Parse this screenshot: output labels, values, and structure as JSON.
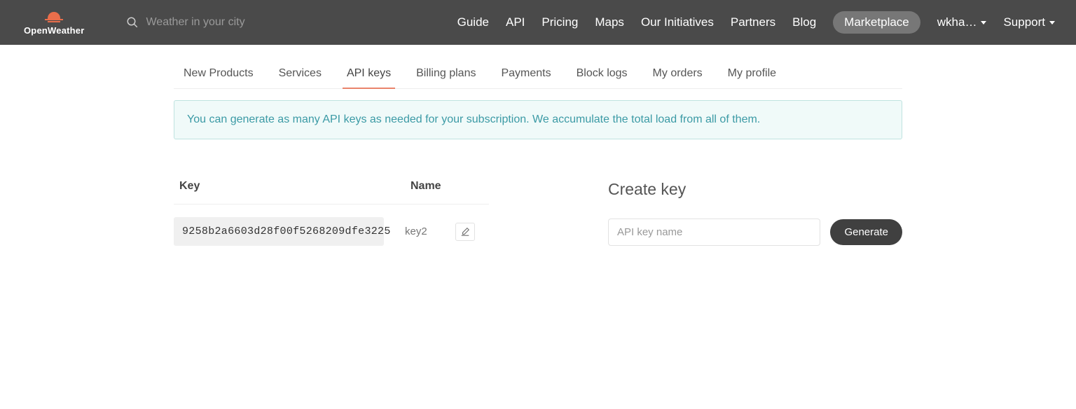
{
  "brand": {
    "name": "OpenWeather"
  },
  "search": {
    "placeholder": "Weather in your city"
  },
  "nav": {
    "guide": "Guide",
    "api": "API",
    "pricing": "Pricing",
    "maps": "Maps",
    "initiatives": "Our Initiatives",
    "partners": "Partners",
    "blog": "Blog",
    "marketplace": "Marketplace",
    "user": "wkha…",
    "support": "Support"
  },
  "tabs": {
    "new_products": "New Products",
    "services": "Services",
    "api_keys": "API keys",
    "billing": "Billing plans",
    "payments": "Payments",
    "block_logs": "Block logs",
    "my_orders": "My orders",
    "my_profile": "My profile"
  },
  "banner": "You can generate as many API keys as needed for your subscription. We accumulate the total load from all of them.",
  "table": {
    "key_header": "Key",
    "name_header": "Name",
    "rows": [
      {
        "key": "9258b2a6603d28f00f5268209dfe3225",
        "name": "key2"
      }
    ]
  },
  "create": {
    "title": "Create key",
    "placeholder": "API key name",
    "button": "Generate"
  }
}
